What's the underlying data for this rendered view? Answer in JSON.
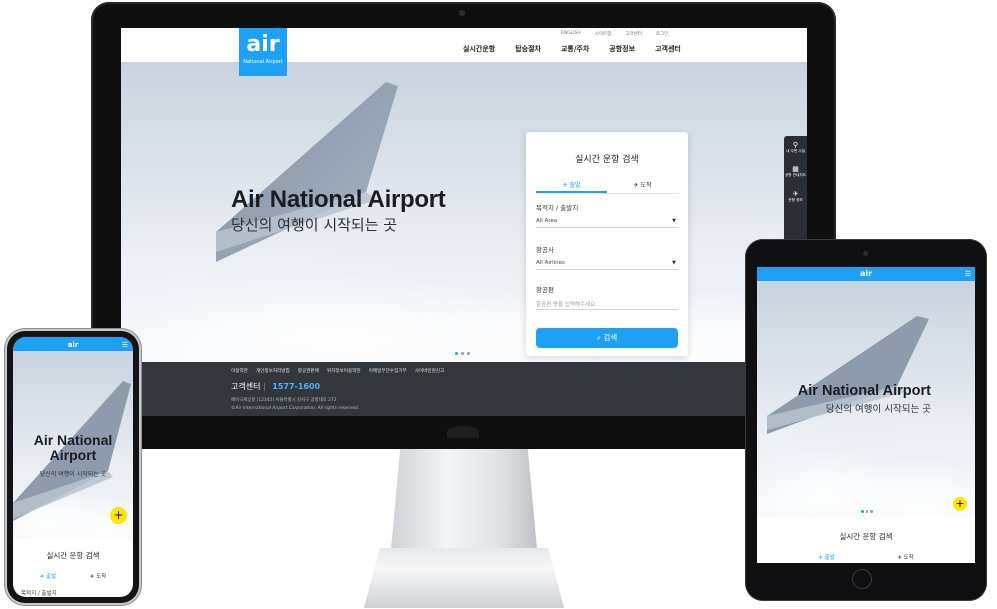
{
  "brand": {
    "logo_text": "air",
    "logo_sub": "National Airport",
    "accent": "#1ea0f5",
    "highlight": "#ffe600"
  },
  "desktop": {
    "util_links": [
      "ENGLISH",
      "사이트맵",
      "고객센터",
      "로그인"
    ],
    "nav": [
      "실시간운항",
      "탑승절차",
      "교통/주차",
      "공항정보",
      "고객센터"
    ],
    "hero": {
      "title": "Air National Airport",
      "subtitle": "당신의 여행이 시작되는 곳"
    },
    "search_card": {
      "title": "실시간 운항 검색",
      "tab_departure": "출발",
      "tab_arrival": "도착",
      "dest_label": "목적지 / 출발지",
      "dest_value": "All Area",
      "airline_label": "항공사",
      "airline_value": "All Airlines",
      "flight_label": "항공편",
      "flight_placeholder": "항공편 명을 입력해주세요.",
      "search_button": "검색"
    },
    "side_bar": [
      {
        "icon": "location-pin-icon",
        "label": "내 주변 시설"
      },
      {
        "icon": "map-icon",
        "label": "공항 안내지도"
      },
      {
        "icon": "flight-icon",
        "label": "운항 정보"
      }
    ],
    "footer": {
      "links": [
        "이용약관",
        "개인정보처리방침",
        "항공권판매",
        "위치정보이용약관",
        "이메일무단수집거부",
        "사이버민원신고"
      ],
      "cs_label": "고객센터",
      "cs_number": "1577-1600",
      "address": "에어국제공항 (12345) 서울특별시 강서구 공항대로 272",
      "copyright": "©Air International Airport Corporation. All rights reserved."
    }
  },
  "tablet": {
    "header_logo": "air",
    "hero_title": "Air National Airport",
    "hero_subtitle": "당신의 여행이 시작되는 곳",
    "card_title": "실시간 운항 검색",
    "tab_departure": "출발",
    "tab_arrival": "도착"
  },
  "phone": {
    "header_logo": "air",
    "hero_title_line1": "Air National",
    "hero_title_line2": "Airport",
    "hero_subtitle": "당신의 여행이 시작되는 곳",
    "card_title": "실시간 운항 검색",
    "tab_departure": "출발",
    "tab_arrival": "도착",
    "dest_label": "목적지 / 출발지"
  }
}
